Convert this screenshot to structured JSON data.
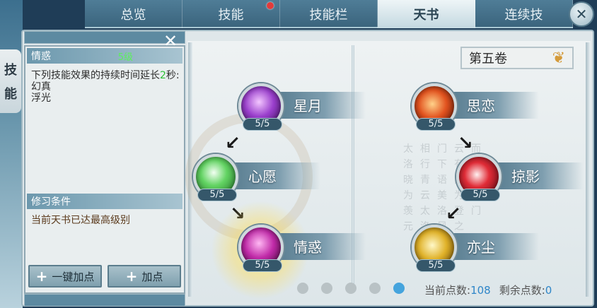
{
  "side_label": [
    "技",
    "能"
  ],
  "tabs": [
    {
      "label": "总览",
      "active": false,
      "badge": false
    },
    {
      "label": "技能",
      "active": false,
      "badge": true
    },
    {
      "label": "技能栏",
      "active": false,
      "badge": false
    },
    {
      "label": "天书",
      "active": true,
      "badge": false
    },
    {
      "label": "连续技",
      "active": false,
      "badge": false
    }
  ],
  "close_icon": "✕",
  "detail": {
    "skill_name": "情惑",
    "level": "5级",
    "desc_prefix": "下列技能效果的持续时间延长",
    "desc_number": "2",
    "desc_suffix": "秒:",
    "skills": [
      "幻真",
      "浮光"
    ],
    "requirement_title": "修习条件",
    "requirement_text": "当前天书已达最高级别"
  },
  "buttons": {
    "one_click": "一键加点",
    "add": "加点"
  },
  "volume": {
    "label": "第五卷"
  },
  "nodes": {
    "xingyue": {
      "name": "星月",
      "count": "5/5"
    },
    "xinyuan": {
      "name": "心愿",
      "count": "5/5"
    },
    "qinghuo": {
      "name": "情惑",
      "count": "5/5"
    },
    "silian": {
      "name": "思恋",
      "count": "5/5"
    },
    "lueying": {
      "name": "掠影",
      "count": "5/5"
    },
    "yichen": {
      "name": "亦尘",
      "count": "5/5"
    }
  },
  "pager": {
    "total": 5,
    "current": 5
  },
  "points": {
    "current_label": "当前点数:",
    "current_value": "108",
    "remaining_label": "剩余点数:",
    "remaining_value": "0"
  },
  "colors": {
    "accent": "#45a4dd",
    "level_green": "#5cf05c",
    "badge_red": "#e23b3b"
  }
}
